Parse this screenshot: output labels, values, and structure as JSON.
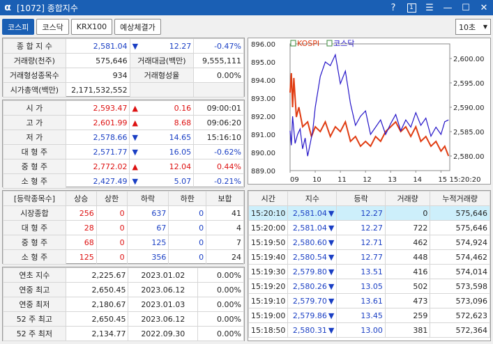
{
  "titlebar": {
    "logo": "α",
    "title": "[1072] 종합지수",
    "help": "?",
    "num": "1",
    "menu": "☰",
    "minimize": "—",
    "maximize": "☐",
    "close": "✕"
  },
  "tabs": [
    {
      "label": "코스피"
    },
    {
      "label": "코스닥"
    },
    {
      "label": "KRX100"
    },
    {
      "label": "예상체결가"
    }
  ],
  "interval": {
    "value": "10초"
  },
  "summary": {
    "index_label": "종 합 지 수",
    "index_value": "2,581.04",
    "index_change": "12.27",
    "index_rate": "-0.47%",
    "vol_label": "거래량(천주)",
    "vol_value": "575,646",
    "amt_label": "거래대금(백만)",
    "amt_value": "9,555,111",
    "form_cnt_label": "거래형성종목수",
    "form_cnt_value": "934",
    "form_rate_label": "거래형성율",
    "form_rate_value": "0.00%",
    "mcap_label": "시가총액(백만)",
    "mcap_value": "2,171,532,552"
  },
  "prices": [
    {
      "label": "시    가",
      "value": "2,593.47",
      "dir": "up",
      "change": "0.16",
      "extra": "09:00:01",
      "vc": "red",
      "ec": ""
    },
    {
      "label": "고    가",
      "value": "2,601.99",
      "dir": "up",
      "change": "8.68",
      "extra": "09:06:20",
      "vc": "red",
      "ec": ""
    },
    {
      "label": "저    가",
      "value": "2,578.66",
      "dir": "down",
      "change": "14.65",
      "extra": "15:16:10",
      "vc": "blue",
      "ec": ""
    },
    {
      "label": "대 형 주",
      "value": "2,571.77",
      "dir": "down",
      "change": "16.05",
      "extra": "-0.62%",
      "vc": "blue",
      "ec": "blue"
    },
    {
      "label": "중 형 주",
      "value": "2,772.02",
      "dir": "up",
      "change": "12.04",
      "extra": "0.44%",
      "vc": "red",
      "ec": "red"
    },
    {
      "label": "소 형 주",
      "value": "2,427.49",
      "dir": "down",
      "change": "5.07",
      "extra": "-0.21%",
      "vc": "blue",
      "ec": "blue"
    }
  ],
  "breadth": {
    "headers": [
      "[등락종목수]",
      "상승",
      "상한",
      "하락",
      "하한",
      "보합"
    ],
    "rows": [
      {
        "label": "시장종합",
        "up": "256",
        "upper": "0",
        "down": "637",
        "lower": "0",
        "flat": "41"
      },
      {
        "label": "대 형 주",
        "up": "28",
        "upper": "0",
        "down": "67",
        "lower": "0",
        "flat": "4"
      },
      {
        "label": "중 형 주",
        "up": "68",
        "upper": "0",
        "down": "125",
        "lower": "0",
        "flat": "7"
      },
      {
        "label": "소 형 주",
        "up": "125",
        "upper": "0",
        "down": "356",
        "lower": "0",
        "flat": "24"
      }
    ]
  },
  "yearly": [
    {
      "label": "연초  지수",
      "value": "2,225.67",
      "date": "2023.01.02",
      "rate": "0.00%"
    },
    {
      "label": "연중  최고",
      "value": "2,650.45",
      "date": "2023.06.12",
      "rate": "0.00%"
    },
    {
      "label": "연중  최저",
      "value": "2,180.67",
      "date": "2023.01.03",
      "rate": "0.00%"
    },
    {
      "label": "52 주 최고",
      "value": "2,650.45",
      "date": "2023.06.12",
      "rate": "0.00%"
    },
    {
      "label": "52 주 최저",
      "value": "2,134.77",
      "date": "2022.09.30",
      "rate": "0.00%"
    }
  ],
  "ticks": {
    "headers": [
      "시간",
      "지수",
      "등락",
      "거래량",
      "누적거래량"
    ],
    "rows": [
      {
        "time": "15:20:10",
        "index": "2,581.04",
        "change": "12.27",
        "vol": "0",
        "cum": "575,646"
      },
      {
        "time": "15:20:00",
        "index": "2,581.04",
        "change": "12.27",
        "vol": "722",
        "cum": "575,646"
      },
      {
        "time": "15:19:50",
        "index": "2,580.60",
        "change": "12.71",
        "vol": "462",
        "cum": "574,924"
      },
      {
        "time": "15:19:40",
        "index": "2,580.54",
        "change": "12.77",
        "vol": "448",
        "cum": "574,462"
      },
      {
        "time": "15:19:30",
        "index": "2,579.80",
        "change": "13.51",
        "vol": "416",
        "cum": "574,014"
      },
      {
        "time": "15:19:20",
        "index": "2,580.26",
        "change": "13.05",
        "vol": "502",
        "cum": "573,598"
      },
      {
        "time": "15:19:10",
        "index": "2,579.70",
        "change": "13.61",
        "vol": "473",
        "cum": "573,096"
      },
      {
        "time": "15:19:00",
        "index": "2,579.86",
        "change": "13.45",
        "vol": "259",
        "cum": "572,623"
      },
      {
        "time": "15:18:50",
        "index": "2,580.31",
        "change": "13.00",
        "vol": "381",
        "cum": "572,364"
      }
    ]
  },
  "chart_data": {
    "type": "line",
    "legend": [
      {
        "name": "KOSPI",
        "color": "#e03c12"
      },
      {
        "name": "코스닥",
        "color": "#2414c8"
      }
    ],
    "x_ticks": [
      "09",
      "10",
      "11",
      "12",
      "13",
      "14",
      "15",
      "15:20:20"
    ],
    "left_ticks": [
      "896.00",
      "895.00",
      "894.00",
      "893.00",
      "892.00",
      "891.00",
      "890.00",
      "889.00"
    ],
    "right_ticks": [
      "2,600.00",
      "2,595.00",
      "2,590.00",
      "2,585.00",
      "2,580.00"
    ],
    "ylim_left": [
      889,
      896
    ],
    "ylim_right": [
      2577,
      2603
    ],
    "series": [
      {
        "name": "KOSPI",
        "axis": "right",
        "color": "#e03c12",
        "x": [
          9.0,
          9.05,
          9.1,
          9.15,
          9.25,
          9.35,
          9.5,
          9.7,
          9.85,
          10.0,
          10.2,
          10.4,
          10.6,
          10.8,
          11.0,
          11.2,
          11.4,
          11.6,
          11.8,
          12.0,
          12.2,
          12.4,
          12.6,
          12.8,
          13.0,
          13.2,
          13.4,
          13.6,
          13.8,
          14.0,
          14.2,
          14.4,
          14.6,
          14.8,
          15.0,
          15.15,
          15.3
        ],
        "y": [
          2593,
          2597,
          2590,
          2596,
          2588,
          2590,
          2586,
          2587,
          2584,
          2586,
          2585,
          2587,
          2584,
          2586,
          2585,
          2587,
          2583,
          2584,
          2582,
          2583,
          2582,
          2584,
          2583,
          2585,
          2586,
          2587,
          2585,
          2586,
          2584,
          2586,
          2583,
          2584,
          2582,
          2583,
          2581,
          2582,
          2580
        ]
      },
      {
        "name": "코스닥",
        "axis": "left",
        "color": "#2414c8",
        "x": [
          9.0,
          9.05,
          9.1,
          9.2,
          9.3,
          9.4,
          9.5,
          9.6,
          9.7,
          9.8,
          9.9,
          10.0,
          10.2,
          10.4,
          10.6,
          10.8,
          11.0,
          11.2,
          11.4,
          11.6,
          11.8,
          12.0,
          12.2,
          12.4,
          12.6,
          12.8,
          13.0,
          13.2,
          13.4,
          13.6,
          13.8,
          14.0,
          14.2,
          14.4,
          14.6,
          14.8,
          15.0,
          15.15,
          15.3
        ],
        "y": [
          891.2,
          890.4,
          892.0,
          890.5,
          891.0,
          891.3,
          890.2,
          890.8,
          889.8,
          890.5,
          891.2,
          892.5,
          894.2,
          895.0,
          894.8,
          895.4,
          893.8,
          894.5,
          892.7,
          891.5,
          892.0,
          892.3,
          891.0,
          891.4,
          891.8,
          891.0,
          891.6,
          892.1,
          891.2,
          891.8,
          891.4,
          892.2,
          891.5,
          891.9,
          890.9,
          891.4,
          891.0,
          891.7,
          891.8
        ]
      }
    ]
  }
}
